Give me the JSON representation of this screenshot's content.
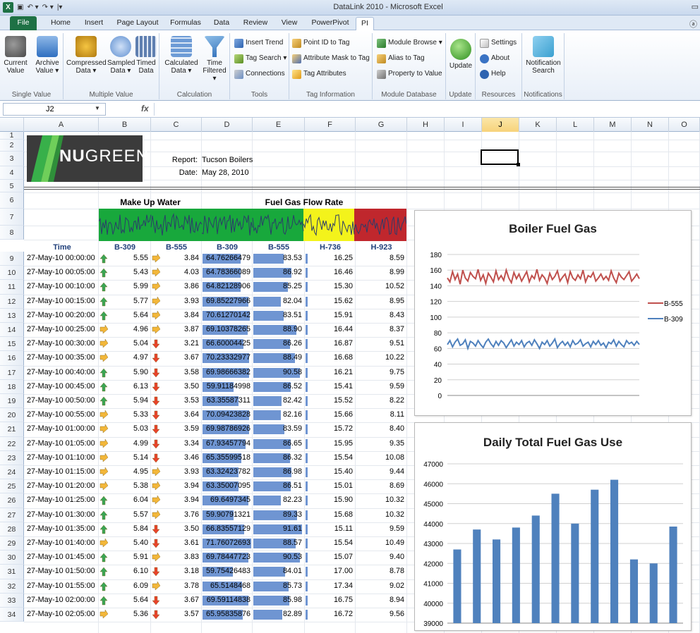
{
  "window": {
    "title": "DataLink 2010 - Microsoft Excel",
    "app_logo": "X",
    "minimize_glyph": "▭",
    "help_glyph": "ⓐ"
  },
  "tabs": [
    "File",
    "Home",
    "Insert",
    "Page Layout",
    "Formulas",
    "Data",
    "Review",
    "View",
    "PowerPivot",
    "PI"
  ],
  "active_tab": "PI",
  "ribbon": {
    "groups": {
      "single_value": "Single Value",
      "multiple_value": "Multiple Value",
      "calculation": "Calculation",
      "tools": "Tools",
      "tag_information": "Tag Information",
      "module_database": "Module Database",
      "update": "Update",
      "resources": "Resources",
      "notifications": "Notifications"
    },
    "current_value": [
      "Current",
      "Value"
    ],
    "archive_value": [
      "Archive",
      "Value ▾"
    ],
    "compressed_data": [
      "Compressed",
      "Data ▾"
    ],
    "sampled_data": [
      "Sampled",
      "Data ▾"
    ],
    "timed_data": [
      "Timed",
      "Data"
    ],
    "calculated_data": [
      "Calculated",
      "Data ▾"
    ],
    "time_filtered": [
      "Time",
      "Filtered ▾"
    ],
    "insert_trend": "Insert Trend",
    "tag_search": "Tag Search ▾",
    "connections": "Connections",
    "point_id_to_tag": "Point ID to Tag",
    "attribute_mask_to_tag": "Attribute Mask to Tag",
    "tag_attributes": "Tag Attributes",
    "module_browse": "Module Browse ▾",
    "alias_to_tag": "Alias to Tag",
    "property_to_value": "Property to Value",
    "update_btn": "Update",
    "settings": "Settings",
    "about": "About",
    "help": "Help",
    "notification_search": [
      "Notification",
      "Search"
    ]
  },
  "formula_bar": {
    "name_box": "J2",
    "fx": "fx",
    "formula": ""
  },
  "columns": [
    "A",
    "B",
    "C",
    "D",
    "E",
    "F",
    "G",
    "H",
    "I",
    "J",
    "K",
    "L",
    "M",
    "N",
    "O"
  ],
  "selected_column": "J",
  "report": {
    "logo_text_bold": "NU",
    "logo_text_light": "GREEN",
    "report_label": "Report:",
    "report_value": "Tucson Boilers",
    "date_label": "Date:",
    "date_value": "May 28, 2010"
  },
  "table": {
    "group_makeup": "Make Up Water",
    "group_fuelgas": "Fuel Gas Flow Rate",
    "col_time": "Time",
    "col_headers": [
      "B-309",
      "B-555",
      "B-309",
      "B-555",
      "H-736",
      "H-923"
    ],
    "rows": [
      {
        "time": "27-May-10 00:00:00",
        "a1": "up",
        "b": "5.55",
        "a2": "side",
        "c": "3.84",
        "d": "64.76266479",
        "e": "83.53",
        "f": "16.25",
        "g": "8.59"
      },
      {
        "time": "27-May-10 00:05:00",
        "a1": "up",
        "b": "5.43",
        "a2": "side",
        "c": "4.03",
        "d": "64.78366089",
        "e": "86.92",
        "f": "16.46",
        "g": "8.99"
      },
      {
        "time": "27-May-10 00:10:00",
        "a1": "up",
        "b": "5.99",
        "a2": "side",
        "c": "3.86",
        "d": "64.82128906",
        "e": "85.25",
        "f": "15.30",
        "g": "10.52"
      },
      {
        "time": "27-May-10 00:15:00",
        "a1": "up",
        "b": "5.77",
        "a2": "side",
        "c": "3.93",
        "d": "69.85227966",
        "e": "82.04",
        "f": "15.62",
        "g": "8.95"
      },
      {
        "time": "27-May-10 00:20:00",
        "a1": "up",
        "b": "5.64",
        "a2": "side",
        "c": "3.84",
        "d": "70.61270142",
        "e": "83.51",
        "f": "15.91",
        "g": "8.43"
      },
      {
        "time": "27-May-10 00:25:00",
        "a1": "side",
        "b": "4.96",
        "a2": "side",
        "c": "3.87",
        "d": "69.10378265",
        "e": "88.90",
        "f": "16.44",
        "g": "8.37"
      },
      {
        "time": "27-May-10 00:30:00",
        "a1": "side",
        "b": "5.04",
        "a2": "down",
        "c": "3.21",
        "d": "66.60004425",
        "e": "86.26",
        "f": "16.87",
        "g": "9.51"
      },
      {
        "time": "27-May-10 00:35:00",
        "a1": "side",
        "b": "4.97",
        "a2": "down",
        "c": "3.67",
        "d": "70.23332977",
        "e": "88.49",
        "f": "16.68",
        "g": "10.22"
      },
      {
        "time": "27-May-10 00:40:00",
        "a1": "up",
        "b": "5.90",
        "a2": "down",
        "c": "3.58",
        "d": "69.98666382",
        "e": "90.58",
        "f": "16.21",
        "g": "9.75"
      },
      {
        "time": "27-May-10 00:45:00",
        "a1": "up",
        "b": "6.13",
        "a2": "down",
        "c": "3.50",
        "d": "59.91184998",
        "e": "86.52",
        "f": "15.41",
        "g": "9.59"
      },
      {
        "time": "27-May-10 00:50:00",
        "a1": "up",
        "b": "5.94",
        "a2": "down",
        "c": "3.53",
        "d": "63.35587311",
        "e": "82.42",
        "f": "15.52",
        "g": "8.22"
      },
      {
        "time": "27-May-10 00:55:00",
        "a1": "side",
        "b": "5.33",
        "a2": "down",
        "c": "3.64",
        "d": "70.09423828",
        "e": "82.16",
        "f": "15.66",
        "g": "8.11"
      },
      {
        "time": "27-May-10 01:00:00",
        "a1": "side",
        "b": "5.03",
        "a2": "down",
        "c": "3.59",
        "d": "69.98786926",
        "e": "83.59",
        "f": "15.72",
        "g": "8.40"
      },
      {
        "time": "27-May-10 01:05:00",
        "a1": "side",
        "b": "4.99",
        "a2": "down",
        "c": "3.34",
        "d": "67.93457794",
        "e": "86.65",
        "f": "15.95",
        "g": "9.35"
      },
      {
        "time": "27-May-10 01:10:00",
        "a1": "side",
        "b": "5.14",
        "a2": "down",
        "c": "3.46",
        "d": "65.35599518",
        "e": "86.32",
        "f": "15.54",
        "g": "10.08"
      },
      {
        "time": "27-May-10 01:15:00",
        "a1": "side",
        "b": "4.95",
        "a2": "side",
        "c": "3.93",
        "d": "63.32423782",
        "e": "86.98",
        "f": "15.40",
        "g": "9.44"
      },
      {
        "time": "27-May-10 01:20:00",
        "a1": "side",
        "b": "5.38",
        "a2": "side",
        "c": "3.94",
        "d": "63.35007095",
        "e": "86.51",
        "f": "15.01",
        "g": "8.69"
      },
      {
        "time": "27-May-10 01:25:00",
        "a1": "up",
        "b": "6.04",
        "a2": "side",
        "c": "3.94",
        "d": "69.6497345",
        "e": "82.23",
        "f": "15.90",
        "g": "10.32"
      },
      {
        "time": "27-May-10 01:30:00",
        "a1": "up",
        "b": "5.57",
        "a2": "side",
        "c": "3.76",
        "d": "59.90791321",
        "e": "89.33",
        "f": "15.68",
        "g": "10.32"
      },
      {
        "time": "27-May-10 01:35:00",
        "a1": "up",
        "b": "5.84",
        "a2": "down",
        "c": "3.50",
        "d": "66.83557129",
        "e": "91.61",
        "f": "15.11",
        "g": "9.59"
      },
      {
        "time": "27-May-10 01:40:00",
        "a1": "side",
        "b": "5.40",
        "a2": "down",
        "c": "3.61",
        "d": "71.76072693",
        "e": "88.57",
        "f": "15.54",
        "g": "10.49"
      },
      {
        "time": "27-May-10 01:45:00",
        "a1": "up",
        "b": "5.91",
        "a2": "side",
        "c": "3.83",
        "d": "69.78447723",
        "e": "90.53",
        "f": "15.07",
        "g": "9.40"
      },
      {
        "time": "27-May-10 01:50:00",
        "a1": "up",
        "b": "6.10",
        "a2": "down",
        "c": "3.18",
        "d": "59.75426483",
        "e": "84.01",
        "f": "17.00",
        "g": "8.78"
      },
      {
        "time": "27-May-10 01:55:00",
        "a1": "up",
        "b": "6.09",
        "a2": "side",
        "c": "3.78",
        "d": "65.5148468",
        "e": "85.73",
        "f": "17.34",
        "g": "9.02"
      },
      {
        "time": "27-May-10 02:00:00",
        "a1": "up",
        "b": "5.64",
        "a2": "down",
        "c": "3.67",
        "d": "69.59114838",
        "e": "85.98",
        "f": "16.75",
        "g": "8.94"
      },
      {
        "time": "27-May-10 02:05:00",
        "a1": "side",
        "b": "5.36",
        "a2": "down",
        "c": "3.57",
        "d": "65.95835876",
        "e": "82.89",
        "f": "16.72",
        "g": "9.56"
      }
    ]
  },
  "colors": {
    "excel_green": "#1e7145",
    "databar": "#6f95d2",
    "arrow_up": "#3aa655",
    "arrow_side": "#f3b73a",
    "arrow_down": "#e8432b",
    "spark_green": "#18a83c",
    "spark_yellow": "#f3f31b",
    "spark_red": "#c0272d",
    "series_red": "#c0504d",
    "series_blue": "#4f81bd"
  },
  "chart_data": [
    {
      "type": "line",
      "title": "Boiler Fuel Gas",
      "ylim": [
        0,
        180
      ],
      "yticks": [
        0,
        20,
        40,
        60,
        80,
        100,
        120,
        140,
        160,
        180
      ],
      "grid": true,
      "legend": "right",
      "series": [
        {
          "name": "B-555",
          "color": "#c0504d",
          "values": [
            150,
            145,
            158,
            148,
            155,
            142,
            160,
            150,
            146,
            157,
            152,
            149,
            161,
            147,
            154,
            143,
            156,
            151,
            145,
            159,
            148,
            153,
            147,
            160,
            150,
            144,
            157,
            149,
            155,
            146,
            152,
            158,
            145,
            153,
            149,
            161,
            147,
            154,
            150,
            143,
            156,
            148,
            152,
            159,
            146,
            151,
            155,
            144,
            158,
            150,
            147,
            154,
            149,
            160,
            145,
            153,
            151,
            157,
            146,
            150,
            155,
            148,
            152,
            147,
            159,
            150,
            144,
            156,
            151,
            148,
            153,
            158,
            146,
            150,
            155,
            149
          ]
        },
        {
          "name": "B-309",
          "color": "#4f81bd",
          "values": [
            65,
            70,
            62,
            68,
            72,
            64,
            66,
            71,
            60,
            69,
            67,
            63,
            70,
            65,
            61,
            68,
            72,
            66,
            62,
            69,
            64,
            70,
            67,
            61,
            66,
            71,
            63,
            68,
            65,
            70,
            62,
            67,
            69,
            64,
            71,
            66,
            60,
            68,
            65,
            70,
            63,
            67,
            72,
            61,
            66,
            69,
            64,
            68,
            62,
            70,
            65,
            67,
            71,
            63,
            66,
            68,
            62,
            69,
            65,
            70,
            64,
            67,
            61,
            68,
            66,
            71,
            63,
            69,
            65,
            62,
            70,
            66,
            68,
            64,
            69,
            65
          ]
        }
      ]
    },
    {
      "type": "bar",
      "title": "Daily Total Fuel Gas Use",
      "ylim": [
        39000,
        47000
      ],
      "yticks": [
        39000,
        40000,
        41000,
        42000,
        43000,
        44000,
        45000,
        46000,
        47000
      ],
      "grid": true,
      "color": "#4f81bd",
      "values": [
        42700,
        43700,
        43200,
        43800,
        44400,
        45500,
        44000,
        45700,
        46200,
        42200,
        42000,
        43850
      ]
    }
  ]
}
